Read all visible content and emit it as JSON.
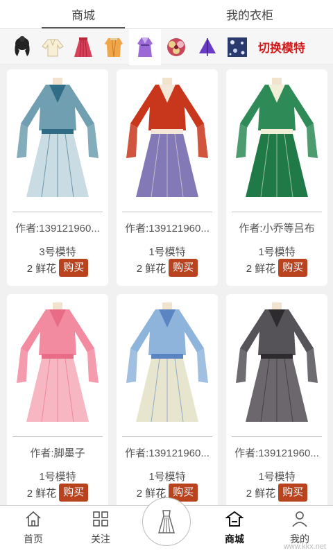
{
  "top_tabs": [
    {
      "label": "商城",
      "active": true
    },
    {
      "label": "我的衣柜",
      "active": false
    }
  ],
  "categories": [
    {
      "icon": "hairstyle-icon"
    },
    {
      "icon": "top-shirt-icon"
    },
    {
      "icon": "skirt-icon"
    },
    {
      "icon": "robe-icon"
    },
    {
      "icon": "full-outfit-icon",
      "active": true
    },
    {
      "icon": "headdress-flower-icon"
    },
    {
      "icon": "fan-accessory-icon"
    },
    {
      "icon": "background-pattern-icon"
    }
  ],
  "switch_model_label": "切换模特",
  "products": [
    {
      "author": "作者:139121960...",
      "model": "3号模特",
      "price": "2 鲜花",
      "buy": "购买",
      "palette": {
        "main": "#6f9fb0",
        "skirt": "#c9dbe3",
        "trim": "#2f6c86"
      }
    },
    {
      "author": "作者:139121960...",
      "model": "1号模特",
      "price": "2 鲜花",
      "buy": "购买",
      "palette": {
        "main": "#c8361c",
        "skirt": "#8379b7",
        "trim": "#f3e7d8"
      }
    },
    {
      "author": "作者:小乔等吕布",
      "model": "1号模特",
      "price": "2 鲜花",
      "buy": "购买",
      "palette": {
        "main": "#2e8b57",
        "skirt": "#1f7a47",
        "trim": "#f2efd8"
      }
    },
    {
      "author": "作者:脚墨子",
      "model": "1号模特",
      "price": "2 鲜花",
      "buy": "购买",
      "palette": {
        "main": "#f28aa0",
        "skirt": "#f6b6c2",
        "trim": "#e86c86"
      }
    },
    {
      "author": "作者:139121960...",
      "model": "1号模特",
      "price": "2 鲜花",
      "buy": "购买",
      "palette": {
        "main": "#8fb4dc",
        "skirt": "#e8e5cf",
        "trim": "#5b84c2"
      }
    },
    {
      "author": "作者:139121960...",
      "model": "1号模特",
      "price": "2 鲜花",
      "buy": "购买",
      "palette": {
        "main": "#555258",
        "skirt": "#6b676c",
        "trim": "#2d2b2e"
      }
    }
  ],
  "bottom_nav": [
    {
      "label": "首页",
      "icon": "home-icon"
    },
    {
      "label": "关注",
      "icon": "grid-icon"
    },
    {
      "label": "商城",
      "icon": "shop-icon",
      "active": true
    },
    {
      "label": "我的",
      "icon": "user-icon"
    }
  ],
  "center_button_icon": "dress-icon",
  "watermark": "www.kkx.net"
}
